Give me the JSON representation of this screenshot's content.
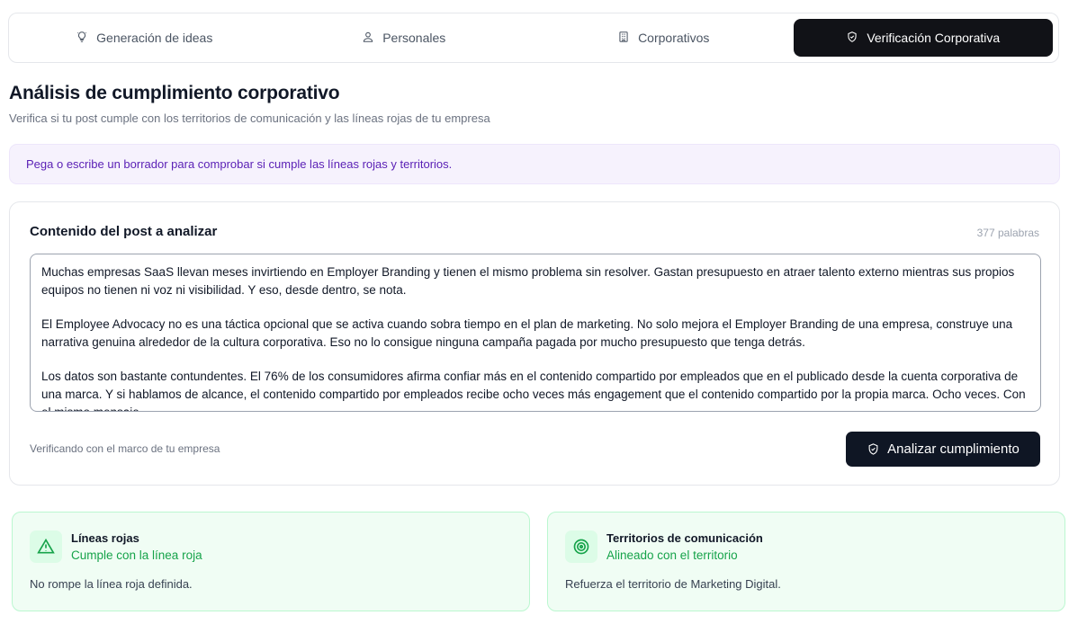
{
  "tabs": [
    {
      "label": "Generación de ideas",
      "icon": "lightbulb-icon",
      "active": false
    },
    {
      "label": "Personales",
      "icon": "user-icon",
      "active": false
    },
    {
      "label": "Corporativos",
      "icon": "building-icon",
      "active": false
    },
    {
      "label": "Verificación Corporativa",
      "icon": "shield-check-icon",
      "active": true
    }
  ],
  "page": {
    "title": "Análisis de cumplimiento corporativo",
    "subtitle": "Verifica si tu post cumple con los territorios de comunicación y las líneas rojas de tu empresa"
  },
  "banner": {
    "text": "Pega o escribe un borrador para comprobar si cumple las líneas rojas y territorios."
  },
  "editor": {
    "title": "Contenido del post a analizar",
    "word_count": "377 palabras",
    "paragraphs": [
      "Muchas empresas SaaS llevan meses invirtiendo en Employer Branding y tienen el mismo problema sin resolver. Gastan presupuesto en atraer talento externo mientras sus propios equipos no tienen ni voz ni visibilidad. Y eso, desde dentro, se nota.",
      "El Employee Advocacy no es una táctica opcional que se activa cuando sobra tiempo en el plan de marketing. No solo mejora el Employer Branding de una empresa, construye una narrativa genuina alrededor de la cultura corporativa. Eso no lo consigue ninguna campaña pagada por mucho presupuesto que tenga detrás.",
      "Los datos son bastante contundentes. El 76% de los consumidores afirma confiar más en el contenido compartido por empleados que en el publicado desde la cuenta corporativa de una marca. Y si hablamos de alcance, el contenido compartido por empleados recibe ocho veces más engagement que el contenido compartido por la propia marca. Ocho veces. Con el mismo mensaje."
    ],
    "footer_note": "Verificando con el marco de tu empresa",
    "analyze_label": "Analizar cumplimiento"
  },
  "results": {
    "red_lines": {
      "title": "Líneas rojas",
      "status": "Cumple con la línea roja",
      "description": "No rompe la línea roja definida.",
      "icon": "warning-triangle-icon"
    },
    "territories": {
      "title": "Territorios de comunicación",
      "status": "Alineado con el territorio",
      "description": "Refuerza el territorio de Marketing Digital.",
      "icon": "target-icon"
    }
  },
  "colors": {
    "active_tab": "#111217",
    "banner_bg": "#f6f2fd",
    "banner_text": "#5b21b6",
    "success": "#16a34a",
    "success_bg": "#f0fdf4"
  }
}
